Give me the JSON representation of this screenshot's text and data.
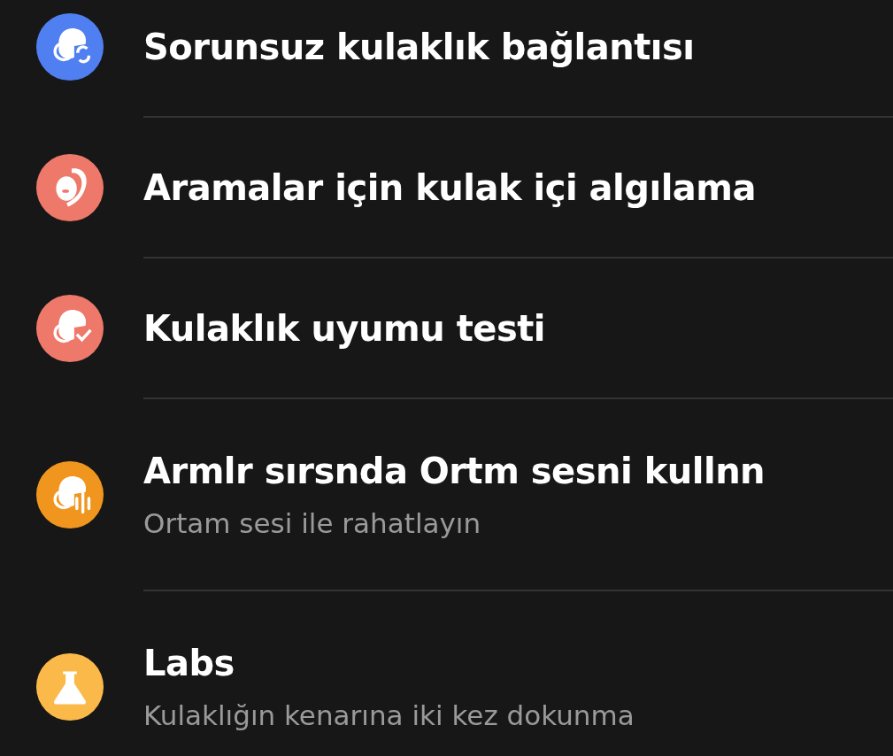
{
  "items": [
    {
      "kind": "earbud-sync",
      "color": "#4f7ff0",
      "title": "Sorunsuz kulaklık bağlantısı"
    },
    {
      "kind": "ear",
      "color": "#ee786a",
      "title": "Aramalar için kulak içi algılama"
    },
    {
      "kind": "earbud-check",
      "color": "#ee786a",
      "title": "Kulaklık uyumu testi"
    },
    {
      "kind": "earbud-sound",
      "color": "#f0961e",
      "title": "Armlr sırsnda Ortm sesni kullnn",
      "subtitle": "Ortam sesi ile rahatlayın"
    },
    {
      "kind": "flask",
      "color": "#fbb94a",
      "title": "Labs",
      "subtitle": "Kulaklığın kenarına iki kez dokunma"
    }
  ]
}
